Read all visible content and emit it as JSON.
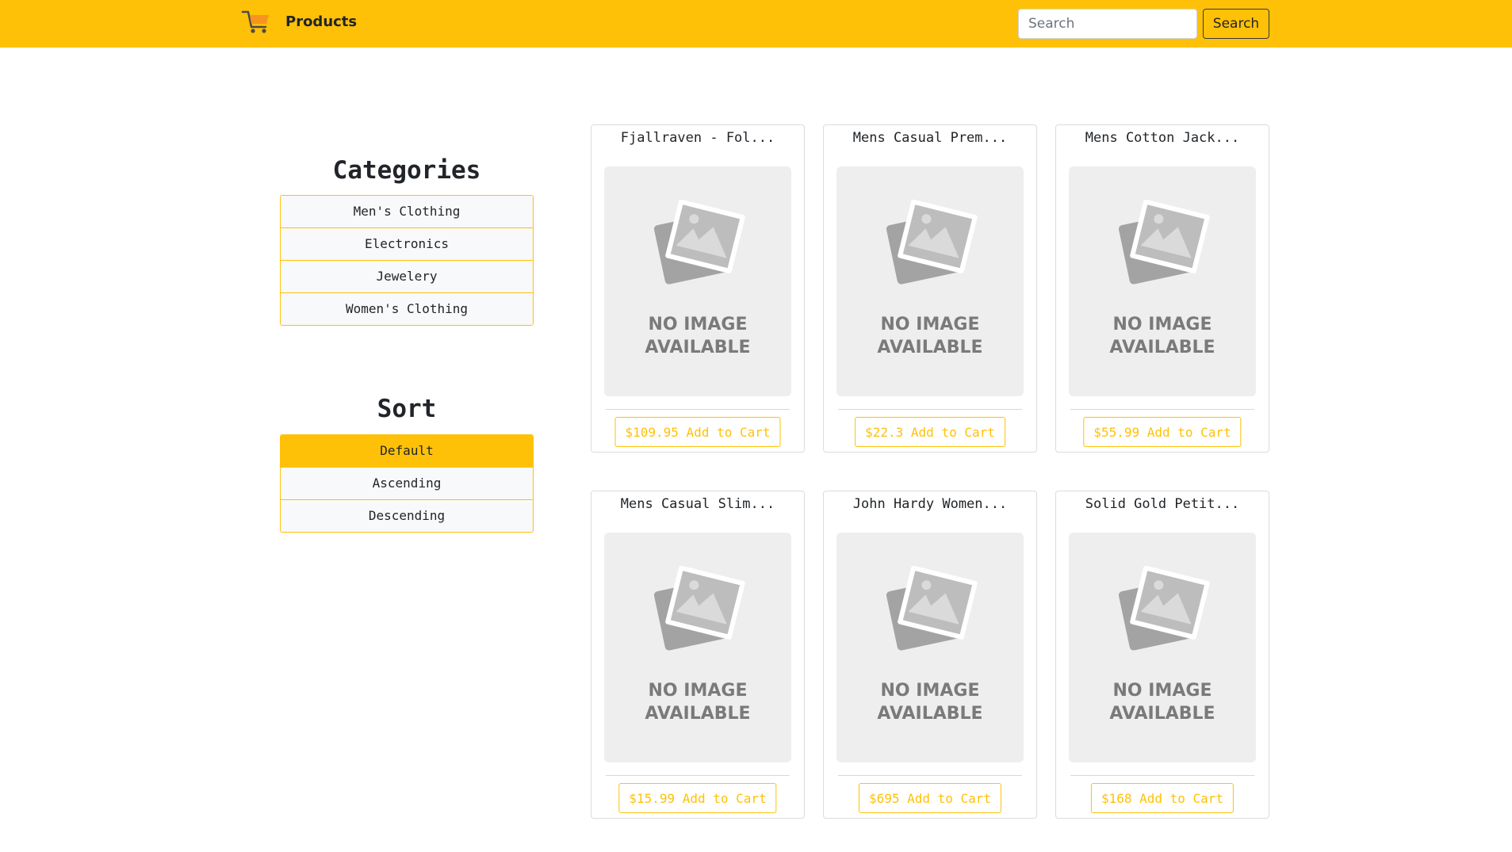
{
  "header": {
    "brand_icon": "shopping-cart-icon",
    "brand_label": "Products",
    "search_placeholder": "Search",
    "search_button": "Search"
  },
  "categories": {
    "title": "Categories",
    "items": [
      "Men's Clothing",
      "Electronics",
      "Jewelery",
      "Women's Clothing"
    ]
  },
  "sort": {
    "title": "Sort",
    "items": [
      "Default",
      "Ascending",
      "Descending"
    ],
    "selected": "Default"
  },
  "products": [
    {
      "title": "Fjallraven - Fol...",
      "image_text_1": "NO IMAGE",
      "image_text_2": "AVAILABLE",
      "button": "$109.95 Add to Cart"
    },
    {
      "title": "Mens Casual Prem...",
      "image_text_1": "NO IMAGE",
      "image_text_2": "AVAILABLE",
      "button": "$22.3 Add to Cart"
    },
    {
      "title": "Mens Cotton Jack...",
      "image_text_1": "NO IMAGE",
      "image_text_2": "AVAILABLE",
      "button": "$55.99 Add to Cart"
    },
    {
      "title": "Mens Casual Slim...",
      "image_text_1": "NO IMAGE",
      "image_text_2": "AVAILABLE",
      "button": "$15.99 Add to Cart"
    },
    {
      "title": "John Hardy Women...",
      "image_text_1": "NO IMAGE",
      "image_text_2": "AVAILABLE",
      "button": "$695 Add to Cart"
    },
    {
      "title": "Solid Gold Petit...",
      "image_text_1": "NO IMAGE",
      "image_text_2": "AVAILABLE",
      "button": "$168 Add to Cart"
    }
  ],
  "colors": {
    "accent": "#ffc107",
    "placeholder_bg": "#eeeeee",
    "placeholder_text": "#7a7a7a"
  }
}
